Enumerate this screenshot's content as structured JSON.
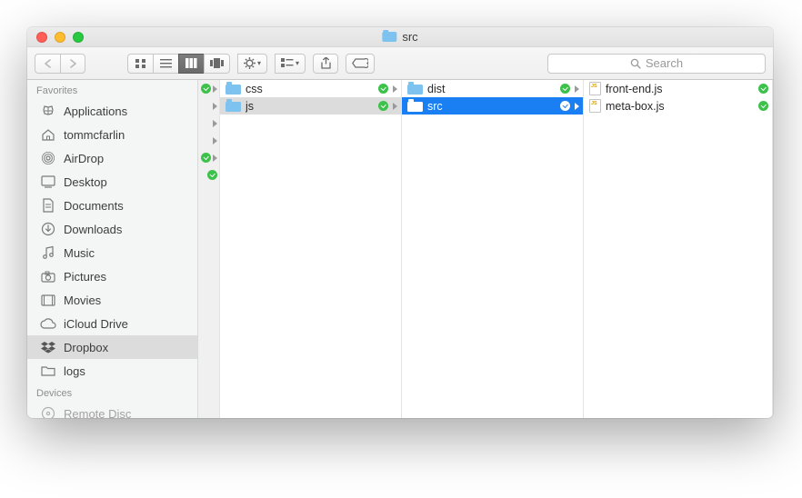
{
  "window": {
    "title": "src"
  },
  "toolbar": {
    "search_placeholder": "Search"
  },
  "sidebar": {
    "section1": "Favorites",
    "section2": "Devices",
    "items": [
      {
        "label": "Applications",
        "icon": "apps"
      },
      {
        "label": "tommcfarlin",
        "icon": "home"
      },
      {
        "label": "AirDrop",
        "icon": "airdrop"
      },
      {
        "label": "Desktop",
        "icon": "desktop"
      },
      {
        "label": "Documents",
        "icon": "documents"
      },
      {
        "label": "Downloads",
        "icon": "downloads"
      },
      {
        "label": "Music",
        "icon": "music"
      },
      {
        "label": "Pictures",
        "icon": "pictures"
      },
      {
        "label": "Movies",
        "icon": "movies"
      },
      {
        "label": "iCloud Drive",
        "icon": "icloud"
      },
      {
        "label": "Dropbox",
        "icon": "dropbox"
      },
      {
        "label": "logs",
        "icon": "folder"
      }
    ],
    "devices": [
      {
        "label": "Remote Disc",
        "icon": "disc"
      }
    ],
    "selected": 10
  },
  "col1": {
    "items": [
      {
        "label": "css",
        "type": "folder"
      },
      {
        "label": "js",
        "type": "folder"
      }
    ],
    "selected": 1
  },
  "col2": {
    "items": [
      {
        "label": "dist",
        "type": "folder"
      },
      {
        "label": "src",
        "type": "folder"
      }
    ],
    "selected": 1
  },
  "col3": {
    "items": [
      {
        "label": "front-end.js",
        "type": "file"
      },
      {
        "label": "meta-box.js",
        "type": "file"
      }
    ]
  }
}
